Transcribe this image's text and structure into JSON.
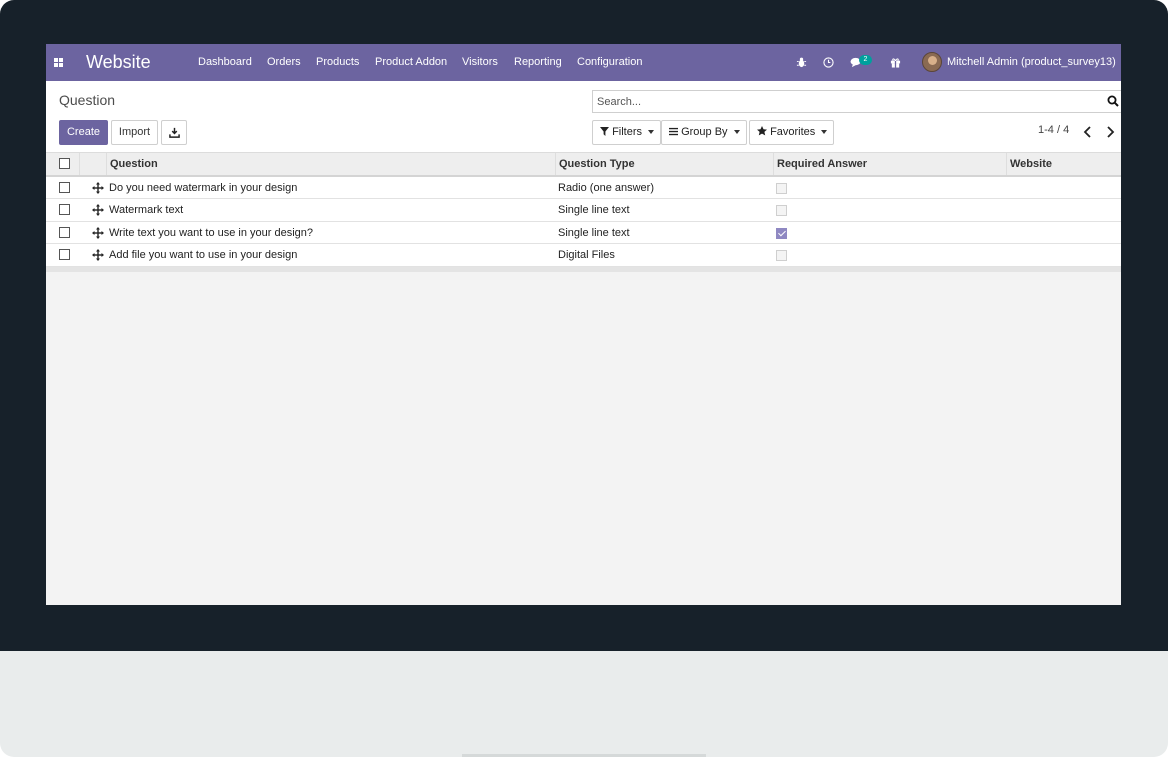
{
  "navbar": {
    "app_title": "Website",
    "menu": [
      "Dashboard",
      "Orders",
      "Products",
      "Product Addon",
      "Visitors",
      "Reporting",
      "Configuration"
    ],
    "messages_count": "2",
    "user_name": "Mitchell Admin (product_survey13)"
  },
  "control_panel": {
    "breadcrumb": "Question",
    "create_label": "Create",
    "import_label": "Import",
    "search_placeholder": "Search...",
    "filters_label": "Filters",
    "group_by_label": "Group By",
    "favorites_label": "Favorites",
    "pager_text": "1-4 / 4"
  },
  "table": {
    "headers": [
      "Question",
      "Question Type",
      "Required Answer",
      "Website"
    ],
    "rows": [
      {
        "question": "Do you need watermark in your design",
        "type": "Radio (one answer)",
        "required": false,
        "website": ""
      },
      {
        "question": "Watermark text",
        "type": "Single line text",
        "required": false,
        "website": ""
      },
      {
        "question": "Write text you want to use in your design?",
        "type": "Single line text",
        "required": true,
        "website": ""
      },
      {
        "question": "Add file you want to use in your design",
        "type": "Digital Files",
        "required": false,
        "website": ""
      }
    ]
  },
  "colors": {
    "brand": "#6c64a0",
    "badge": "#00a09d",
    "bezel": "#17212a"
  }
}
